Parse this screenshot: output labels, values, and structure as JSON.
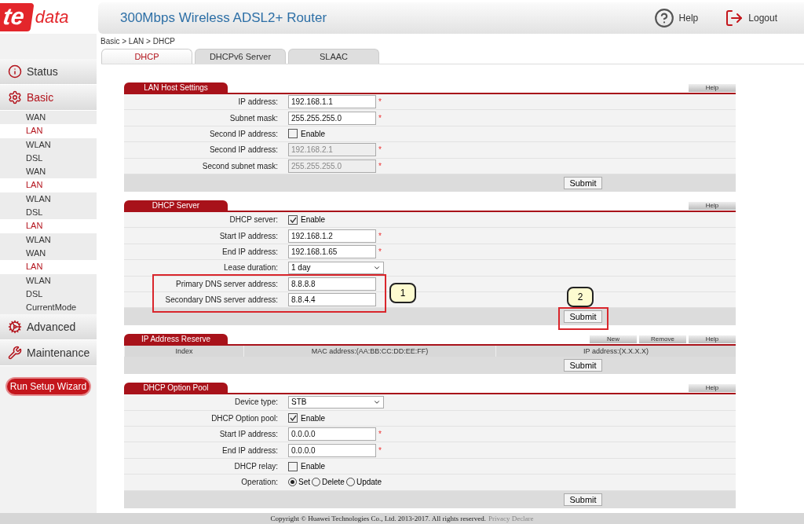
{
  "logo": {
    "mark": "te",
    "word": "data"
  },
  "header": {
    "title": "300Mbps Wireless ADSL2+ Router",
    "help": "Help",
    "logout": "Logout"
  },
  "sidebar": {
    "items": [
      {
        "label": "Status",
        "selected": false
      },
      {
        "label": "Basic",
        "selected": true,
        "children": [
          {
            "label": "WAN",
            "selected": false
          },
          {
            "label": "LAN",
            "selected": true
          },
          {
            "label": "WLAN",
            "selected": false
          },
          {
            "label": "DSL",
            "selected": false
          },
          {
            "label": "WAN",
            "selected": false
          },
          {
            "label": "LAN",
            "selected": true
          },
          {
            "label": "WLAN",
            "selected": false
          },
          {
            "label": "DSL",
            "selected": false
          },
          {
            "label": "LAN",
            "selected": true
          },
          {
            "label": "WLAN",
            "selected": false
          },
          {
            "label": "WAN",
            "selected": false
          },
          {
            "label": "LAN",
            "selected": true
          },
          {
            "label": "WLAN",
            "selected": false
          },
          {
            "label": "DSL",
            "selected": false
          },
          {
            "label": "CurrentMode",
            "selected": false
          }
        ]
      },
      {
        "label": "Advanced",
        "selected": false
      },
      {
        "label": "Maintenance",
        "selected": false
      }
    ],
    "wizard": "Run Setup Wizard"
  },
  "breadcrumb": "Basic > LAN > DHCP",
  "tabs": [
    {
      "label": "DHCP",
      "selected": true
    },
    {
      "label": "DHCPv6 Server",
      "selected": false
    },
    {
      "label": "SLAAC",
      "selected": false
    }
  ],
  "panels": [
    {
      "title": "LAN Host Settings",
      "actions": [
        "Help"
      ],
      "submit": "Submit",
      "rows": [
        {
          "kind": "text",
          "label": "IP address:",
          "value": "192.168.1.1",
          "mark": "*",
          "disabled": false
        },
        {
          "kind": "text",
          "label": "Subnet mask:",
          "value": "255.255.255.0",
          "mark": "*",
          "disabled": false
        },
        {
          "kind": "checkbox",
          "label": "Second IP address:",
          "text": "Enable",
          "checked": false
        },
        {
          "kind": "text",
          "label": "Second IP address:",
          "value": "192.168.2.1",
          "mark": "*",
          "disabled": true
        },
        {
          "kind": "text",
          "label": "Second subnet mask:",
          "value": "255.255.255.0",
          "mark": "*",
          "disabled": true
        }
      ]
    },
    {
      "title": "DHCP Server",
      "actions": [
        "Help"
      ],
      "submit": "Submit",
      "rows": [
        {
          "kind": "checkbox",
          "label": "DHCP server:",
          "text": "Enable",
          "checked": true
        },
        {
          "kind": "text",
          "label": "Start IP address:",
          "value": "192.168.1.2",
          "mark": "*",
          "disabled": false
        },
        {
          "kind": "text",
          "label": "End IP address:",
          "value": "192.168.1.65",
          "mark": "*",
          "disabled": false
        },
        {
          "kind": "select",
          "label": "Lease duration:",
          "value": "1 day"
        },
        {
          "kind": "text",
          "label": "Primary DNS server address:",
          "value": "8.8.8.8",
          "disabled": false
        },
        {
          "kind": "text",
          "label": "Secondary DNS server address:",
          "value": "8.8.4.4",
          "disabled": false
        }
      ]
    },
    {
      "title": "IP Address Reserve",
      "actions": [
        "New",
        "Remove",
        "Help"
      ],
      "submit": "Submit",
      "columns": [
        "Index",
        "MAC address:(AA:BB:CC:DD:EE:FF)",
        "IP address:(X.X.X.X)"
      ]
    },
    {
      "title": "DHCP Option Pool",
      "actions": [
        "Help"
      ],
      "submit": "Submit",
      "rows": [
        {
          "kind": "select",
          "label": "Device type:",
          "value": "STB"
        },
        {
          "kind": "checkbox",
          "label": "DHCP Option pool:",
          "text": "Enable",
          "checked": true
        },
        {
          "kind": "text",
          "label": "Start IP address:",
          "value": "0.0.0.0",
          "mark": "*",
          "disabled": false
        },
        {
          "kind": "text",
          "label": "End IP address:",
          "value": "0.0.0.0",
          "mark": "*",
          "disabled": false
        },
        {
          "kind": "checkbox",
          "label": "DHCP relay:",
          "text": "Enable",
          "checked": false
        },
        {
          "kind": "radio",
          "label": "Operation:",
          "options": [
            {
              "label": "Set",
              "selected": true
            },
            {
              "label": "Delete",
              "selected": false
            },
            {
              "label": "Update",
              "selected": false
            }
          ]
        }
      ]
    }
  ],
  "callouts": [
    {
      "label": "1"
    },
    {
      "label": "2"
    }
  ],
  "footer": {
    "text": "Copyright © Huawei Technologies Co., Ltd. 2013-2017. All rights reserved.",
    "link": "Privacy Declare"
  }
}
